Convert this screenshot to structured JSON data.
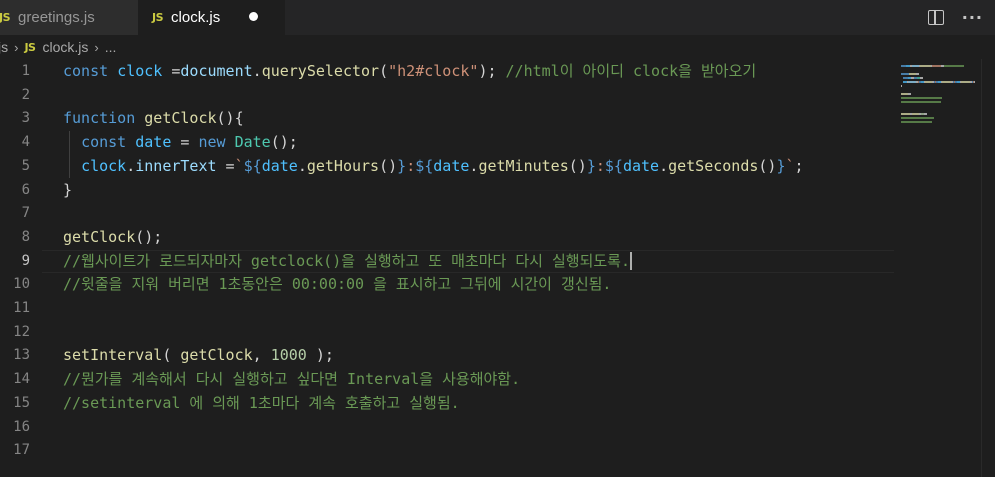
{
  "tabs": [
    {
      "badge": "JS",
      "label": "greetings.js",
      "active": false
    },
    {
      "badge": "JS",
      "label": "clock.js",
      "active": true,
      "dirty": true
    }
  ],
  "tabbar_actions": {
    "split_icon": "split-editor-icon",
    "more_icon": "more-actions-icon",
    "more_glyph": "···"
  },
  "breadcrumb": {
    "folder": "js",
    "file_badge": "JS",
    "file": "clock.js",
    "symbol": "...",
    "separator": "›"
  },
  "editor": {
    "current_line": 9,
    "line_numbers": [
      "1",
      "2",
      "3",
      "4",
      "5",
      "6",
      "7",
      "8",
      "9",
      "10",
      "11",
      "12",
      "13",
      "14",
      "15",
      "16",
      "17"
    ],
    "lines": [
      [
        {
          "t": "const ",
          "c": "kw"
        },
        {
          "t": "clock",
          "c": "var"
        },
        {
          "t": " =",
          "c": "pl"
        },
        {
          "t": "document",
          "c": "prop"
        },
        {
          "t": ".",
          "c": "pl"
        },
        {
          "t": "querySelector",
          "c": "fn"
        },
        {
          "t": "(",
          "c": "pl"
        },
        {
          "t": "\"h2#clock\"",
          "c": "str"
        },
        {
          "t": "); ",
          "c": "pl"
        },
        {
          "t": "//html이 아이디 clock을 받아오기",
          "c": "cm"
        }
      ],
      [],
      [
        {
          "t": "function ",
          "c": "kw"
        },
        {
          "t": "getClock",
          "c": "fn"
        },
        {
          "t": "(){",
          "c": "pl"
        }
      ],
      [
        {
          "t": "  ",
          "c": "pl"
        },
        {
          "t": "const ",
          "c": "kw"
        },
        {
          "t": "date",
          "c": "var"
        },
        {
          "t": " = ",
          "c": "pl"
        },
        {
          "t": "new ",
          "c": "kw"
        },
        {
          "t": "Date",
          "c": "cls"
        },
        {
          "t": "();",
          "c": "pl"
        }
      ],
      [
        {
          "t": "  ",
          "c": "pl"
        },
        {
          "t": "clock",
          "c": "var"
        },
        {
          "t": ".",
          "c": "pl"
        },
        {
          "t": "innerText",
          "c": "prop"
        },
        {
          "t": " =",
          "c": "pl"
        },
        {
          "t": "`",
          "c": "str"
        },
        {
          "t": "${",
          "c": "tpl"
        },
        {
          "t": "date",
          "c": "var"
        },
        {
          "t": ".",
          "c": "pl"
        },
        {
          "t": "getHours",
          "c": "fn"
        },
        {
          "t": "()",
          "c": "pl"
        },
        {
          "t": "}",
          "c": "tpl"
        },
        {
          "t": ":",
          "c": "str"
        },
        {
          "t": "${",
          "c": "tpl"
        },
        {
          "t": "date",
          "c": "var"
        },
        {
          "t": ".",
          "c": "pl"
        },
        {
          "t": "getMinutes",
          "c": "fn"
        },
        {
          "t": "()",
          "c": "pl"
        },
        {
          "t": "}",
          "c": "tpl"
        },
        {
          "t": ":",
          "c": "str"
        },
        {
          "t": "${",
          "c": "tpl"
        },
        {
          "t": "date",
          "c": "var"
        },
        {
          "t": ".",
          "c": "pl"
        },
        {
          "t": "getSeconds",
          "c": "fn"
        },
        {
          "t": "()",
          "c": "pl"
        },
        {
          "t": "}",
          "c": "tpl"
        },
        {
          "t": "`",
          "c": "str"
        },
        {
          "t": ";",
          "c": "pl"
        }
      ],
      [
        {
          "t": "}",
          "c": "pl"
        }
      ],
      [],
      [
        {
          "t": "getClock",
          "c": "fn"
        },
        {
          "t": "();",
          "c": "pl"
        }
      ],
      [
        {
          "t": "//웹사이트가 로드되자마자 getclock()을 실행하고 또 매초마다 다시 실행되도록.",
          "c": "cm"
        }
      ],
      [
        {
          "t": "//윗줄을 지워 버리면 1초동안은 00:00:00 을 표시하고 그뒤에 시간이 갱신됨.",
          "c": "cm"
        }
      ],
      [],
      [],
      [
        {
          "t": "setInterval",
          "c": "fn"
        },
        {
          "t": "( ",
          "c": "pl"
        },
        {
          "t": "getClock",
          "c": "fn"
        },
        {
          "t": ", ",
          "c": "pl"
        },
        {
          "t": "1000",
          "c": "num"
        },
        {
          "t": " );",
          "c": "pl"
        }
      ],
      [
        {
          "t": "//뭔가를 계속해서 다시 실행하고 싶다면 Interval을 사용해야함.",
          "c": "cm"
        }
      ],
      [
        {
          "t": "//setinterval 에 의해 1초마다 계속 호출하고 실행됨.",
          "c": "cm"
        }
      ],
      [],
      []
    ]
  },
  "colors": {
    "keyword": "#569cd6",
    "variable": "#4fc1ff",
    "property": "#9cdcfe",
    "function": "#dcdcaa",
    "string": "#ce9178",
    "class": "#4ec9b0",
    "number": "#b5cea8",
    "comment": "#6a9955",
    "plain": "#d4d4d4",
    "js_badge": "#cbcb41",
    "background": "#1e1e1e"
  }
}
